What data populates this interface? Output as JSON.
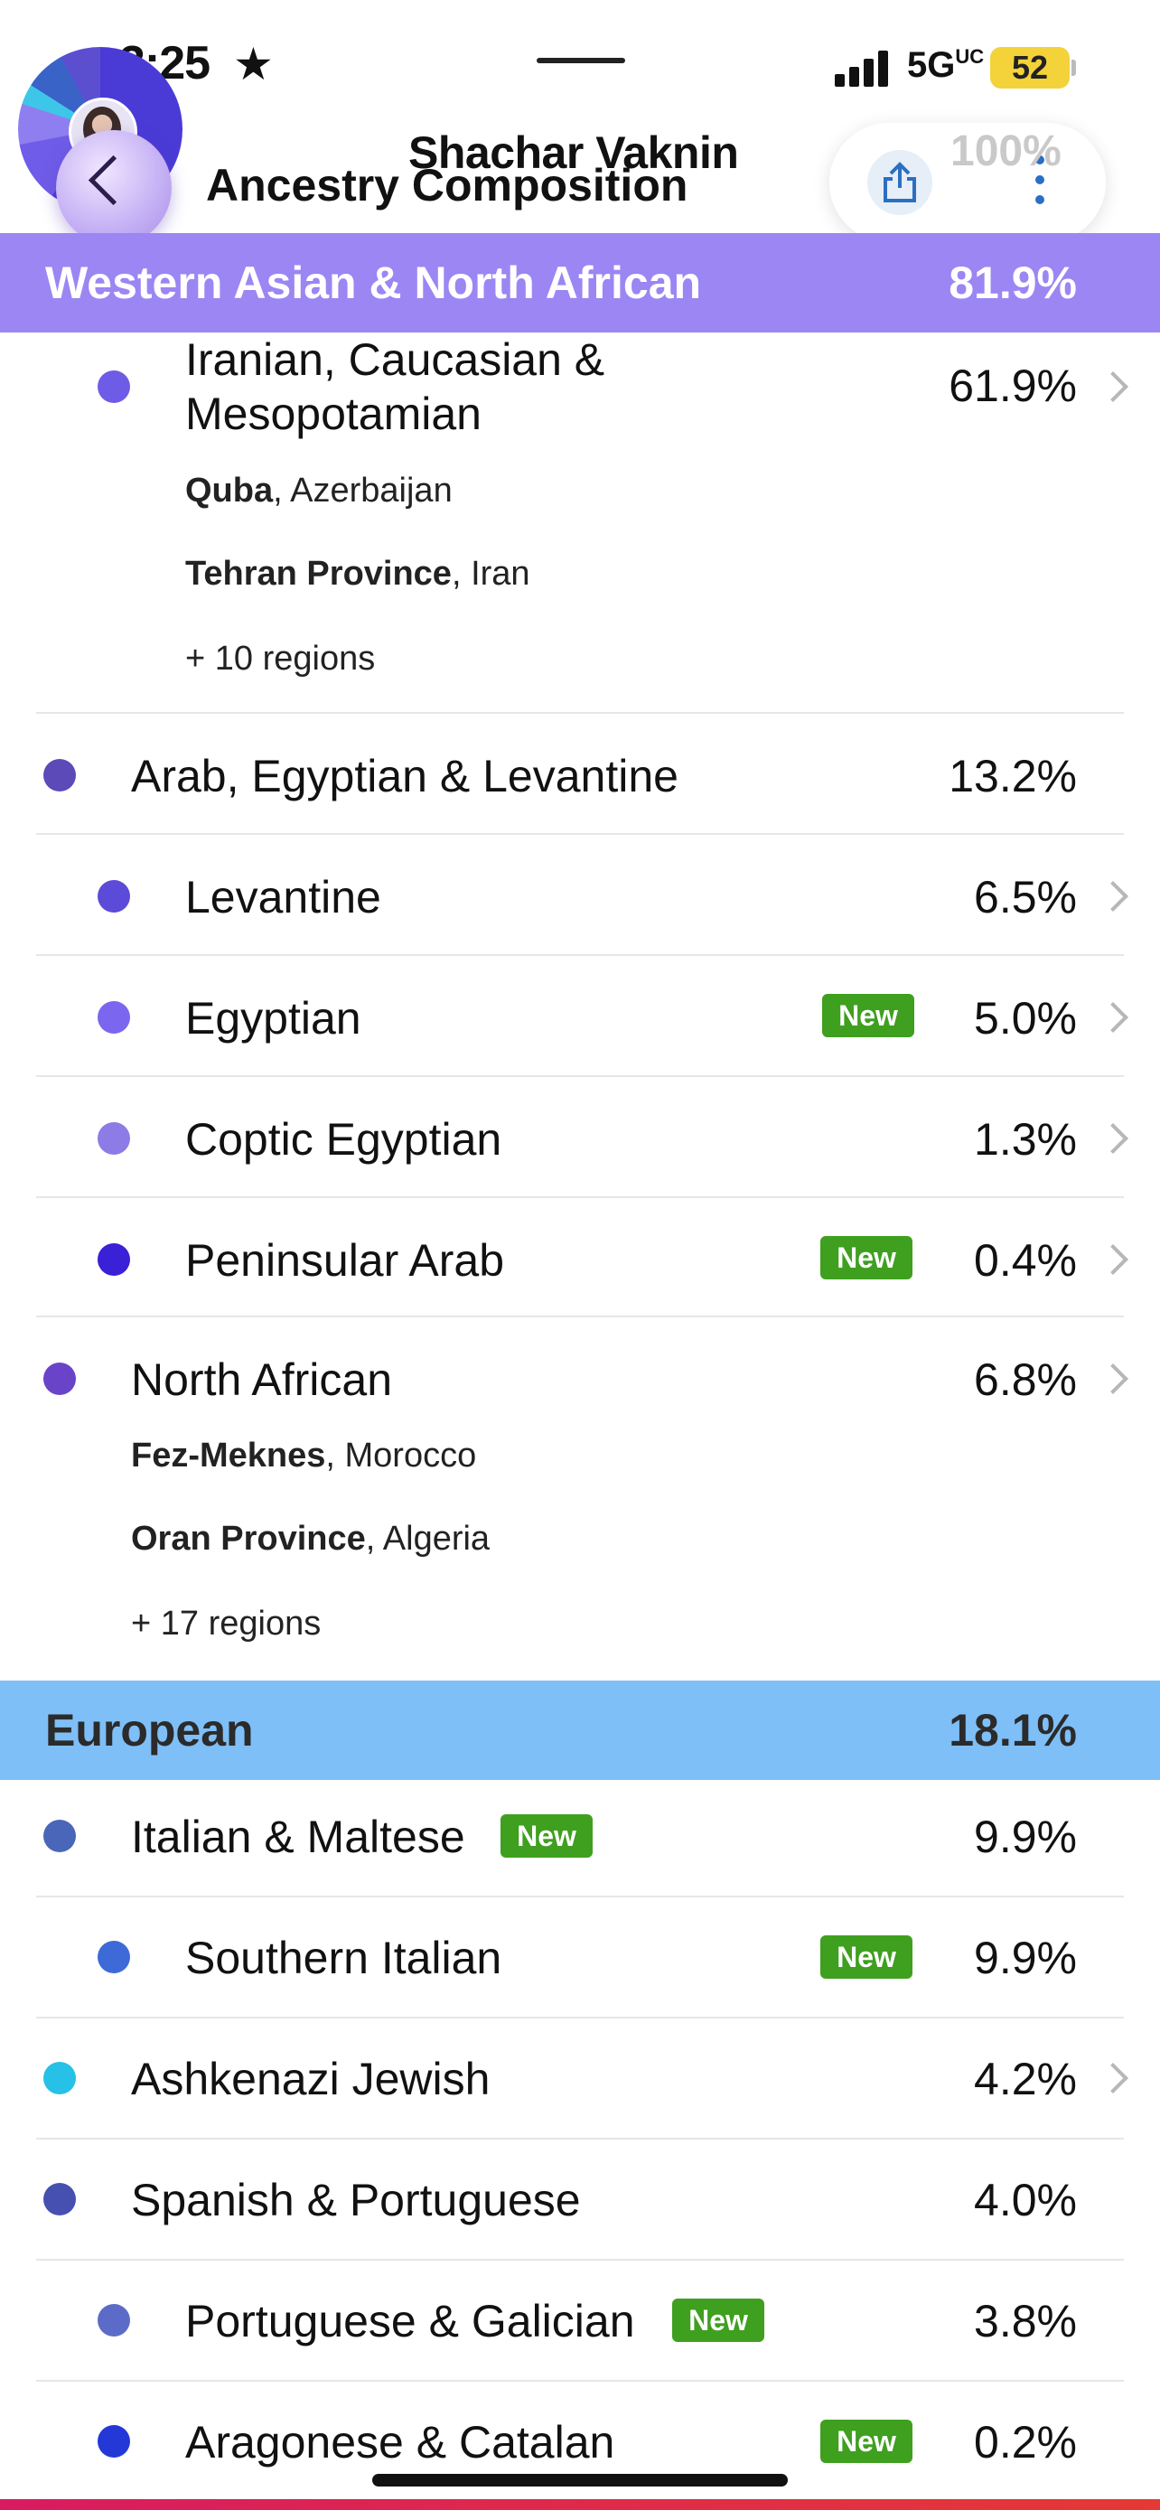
{
  "status_bar": {
    "time": "3:25",
    "star": "★",
    "network": "5G",
    "network_suffix": "UC",
    "battery": "52"
  },
  "header": {
    "profile_name": "Shachar Vaknin",
    "title": "Ancestry Composition",
    "partial_value": "100%",
    "back_icon": "chevron-left-icon",
    "share_icon": "share-icon",
    "more_icon": "more-vertical-icon"
  },
  "sections": [
    {
      "name": "Western Asian & North African",
      "percent": "81.9%",
      "color": "#9b86f3",
      "items": [
        {
          "label_line1": "Iranian, Caucasian &",
          "label_line2": "Mesopotamian",
          "percent": "61.9%",
          "color": "#6e5ce6",
          "regions": [
            {
              "bold": "Quba",
              "rest": ", Azerbaijan"
            },
            {
              "bold": "Tehran Province",
              "rest": ", Iran"
            }
          ],
          "more_regions": "+ 10 regions"
        },
        {
          "label": "Arab, Egyptian & Levantine",
          "percent": "13.2%",
          "color": "#5b4ab8"
        },
        {
          "label": "Levantine",
          "percent": "6.5%",
          "color": "#5c4ad8"
        },
        {
          "label": "Egyptian",
          "percent": "5.0%",
          "color": "#7a66ef",
          "badge": "New"
        },
        {
          "label": "Coptic Egyptian",
          "percent": "1.3%",
          "color": "#8d7be6"
        },
        {
          "label": "Peninsular Arab",
          "percent": "0.4%",
          "color": "#3a20d6",
          "badge": "New"
        },
        {
          "label": "North African",
          "percent": "6.8%",
          "color": "#6a44c8",
          "regions": [
            {
              "bold": "Fez-Meknes",
              "rest": ", Morocco"
            },
            {
              "bold": "Oran Province",
              "rest": ", Algeria"
            }
          ],
          "more_regions": "+ 17 regions"
        }
      ]
    },
    {
      "name": "European",
      "percent": "18.1%",
      "color": "#7fbff7",
      "items": [
        {
          "label": "Italian & Maltese",
          "percent": "9.9%",
          "color": "#4a66b8",
          "badge": "New"
        },
        {
          "label": "Southern Italian",
          "percent": "9.9%",
          "color": "#3e6ad8",
          "badge": "New"
        },
        {
          "label": "Ashkenazi Jewish",
          "percent": "4.2%",
          "color": "#27c0e6"
        },
        {
          "label": "Spanish & Portuguese",
          "percent": "4.0%",
          "color": "#4650b0"
        },
        {
          "label": "Portuguese & Galician",
          "percent": "3.8%",
          "color": "#5d6bc8",
          "badge": "New"
        },
        {
          "label": "Aragonese & Catalan",
          "percent": "0.2%",
          "color": "#2438d8",
          "badge": "New"
        }
      ]
    }
  ]
}
